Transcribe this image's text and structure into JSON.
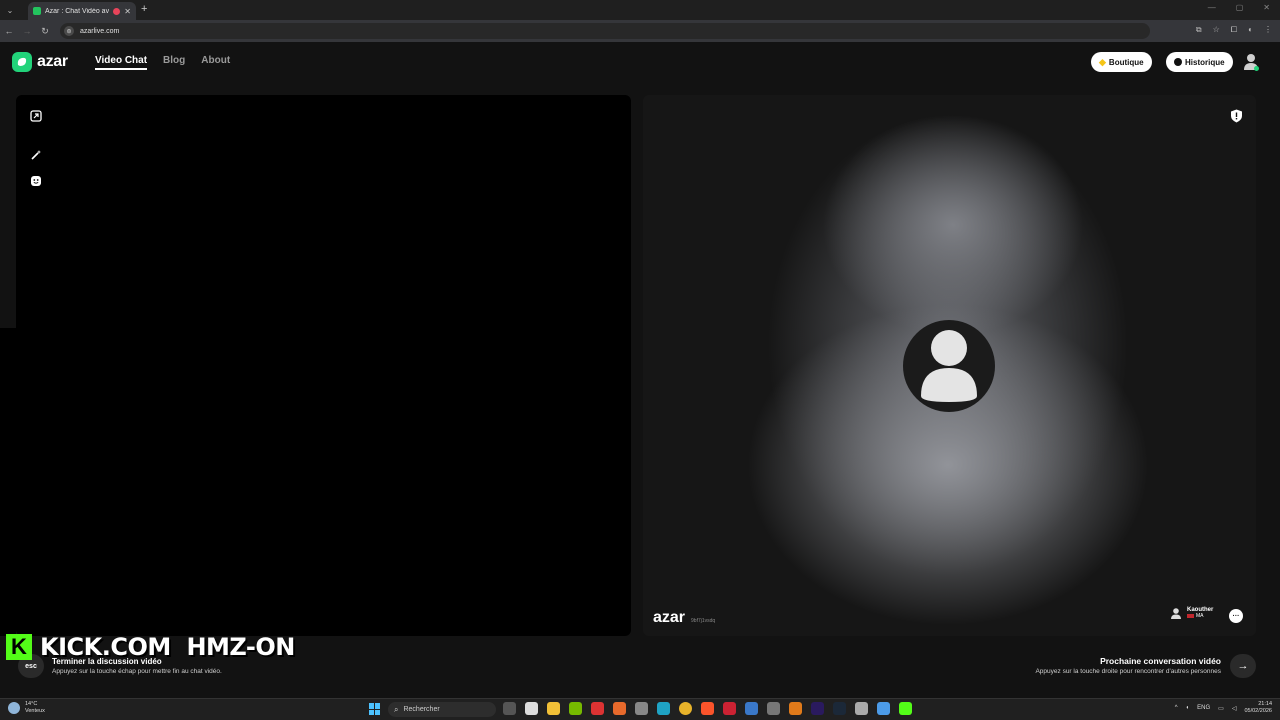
{
  "browser": {
    "tab_title": "Azar : Chat Vidéo avec de n",
    "url": "azarlive.com"
  },
  "header": {
    "logo": "azar",
    "nav": [
      {
        "label": "Video Chat",
        "active": true
      },
      {
        "label": "Blog",
        "active": false
      },
      {
        "label": "About",
        "active": false
      }
    ],
    "boutique_label": "Boutique",
    "historique_label": "Historique"
  },
  "right_pane": {
    "watermark_logo": "azar",
    "watermark_sub": "9bf7j1vsdq",
    "partner_name": "Kaouther",
    "partner_country": "MA"
  },
  "footer": {
    "esc_key": "esc",
    "end_title": "Terminer la discussion vidéo",
    "end_sub": "Appuyez sur la touche échap pour mettre fin au chat vidéo.",
    "next_title": "Prochaine conversation vidéo",
    "next_sub": "Appuyez sur la touche droite pour rencontrer d'autres personnes"
  },
  "overlay": {
    "text": "KICK.COM  HMZ-ON"
  },
  "taskbar": {
    "weather_temp": "14°C",
    "weather_desc": "Venteux",
    "search_placeholder": "Rechercher",
    "lang": "ENG",
    "time": "21:14",
    "date": "05/02/2026"
  },
  "colors": {
    "brand_green": "#22d37a",
    "kick_green": "#53fc18"
  }
}
